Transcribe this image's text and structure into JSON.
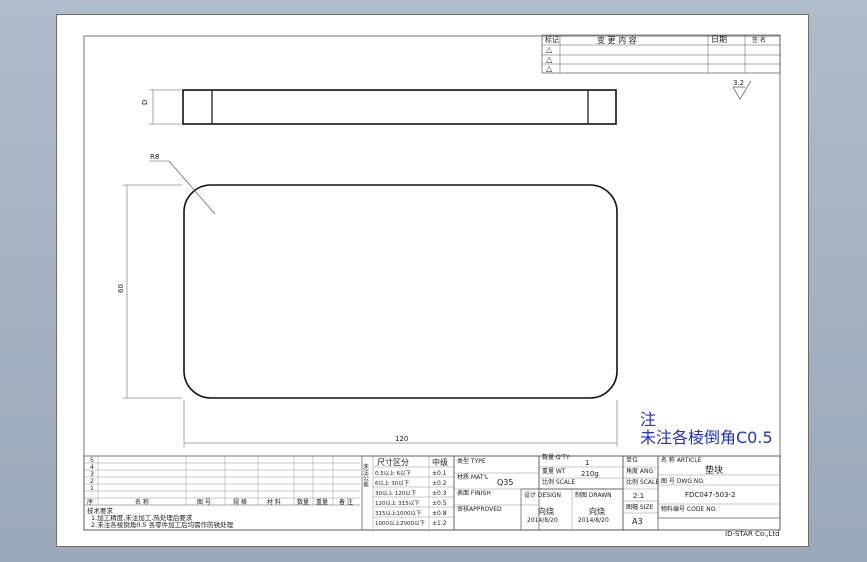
{
  "revision_table": {
    "header_mark": "标记",
    "header_content": "变 更 内 容",
    "header_date": "日期",
    "header_sign": "签 名",
    "rows": [
      "△",
      "△",
      "△"
    ]
  },
  "dimensions": {
    "thickness": "D",
    "radius": "R8",
    "height": "60",
    "width": "120"
  },
  "roughness": "3.2",
  "note": {
    "title": "注",
    "text": "未注各棱倒角C0.5"
  },
  "tech_requirements": {
    "title": "技术要求",
    "items": [
      "1.加工精度,未注加工,热处理后要求",
      "2.未注各棱倒角0.5 各零件加工后均需作防锈处理"
    ]
  },
  "left_table": {
    "row_numbers": [
      "5",
      "4",
      "3",
      "2",
      "1"
    ],
    "bottom_row": [
      "序",
      "名 称",
      "图 号",
      "规 格",
      "材 料",
      "数量",
      "重量",
      "备 注"
    ]
  },
  "tolerance": {
    "header_size": "尺寸区分",
    "header_tol": "中级",
    "rows": [
      {
        "range": "0.5以上 6以下",
        "value": "±0.1"
      },
      {
        "range": "6以上 30以下",
        "value": "±0.2"
      },
      {
        "range": "30以上 120以下",
        "value": "±0.3"
      },
      {
        "range": "120以上 315以下",
        "value": "±0.5"
      },
      {
        "range": "315以上1000以下",
        "value": "±0.8"
      },
      {
        "range": "1000以上2000以下",
        "value": "±1.2"
      }
    ],
    "side_label": "未注公差"
  },
  "material_block": {
    "type_label": "类型 TYPE",
    "material_label": "材质 MAT'L",
    "material_value": "Q35",
    "finish_label": "表面 FINISH",
    "approved_label": "审核APPROVED",
    "design_label": "设计 DESIGN",
    "drawn_label": "制图 DRAWN",
    "design_name": "向烧",
    "drawn_name": "向烧",
    "design_date": "2014/8/20",
    "drawn_date": "2014/8/20"
  },
  "qty_block": {
    "qty_label": "数量 Q'TY",
    "qty_value": "1",
    "weight_label": "重量 WT",
    "weight_value": "210g",
    "scale_label": "比例 SCALE",
    "scale_value": "2:1",
    "size_label": "图幅 SIZE",
    "size_value": "A3",
    "unit_label": "单位",
    "angle_label": "角度 ANG"
  },
  "title_block": {
    "name_label": "名 称 ARTICLE",
    "name_value": "垫块",
    "dwg_label": "图 号 DWG NO.",
    "dwg_value": "FDC047-503-2",
    "code_label": "物料编号 CODE NO.",
    "company": "ID-STAR Co.,Ltd"
  }
}
